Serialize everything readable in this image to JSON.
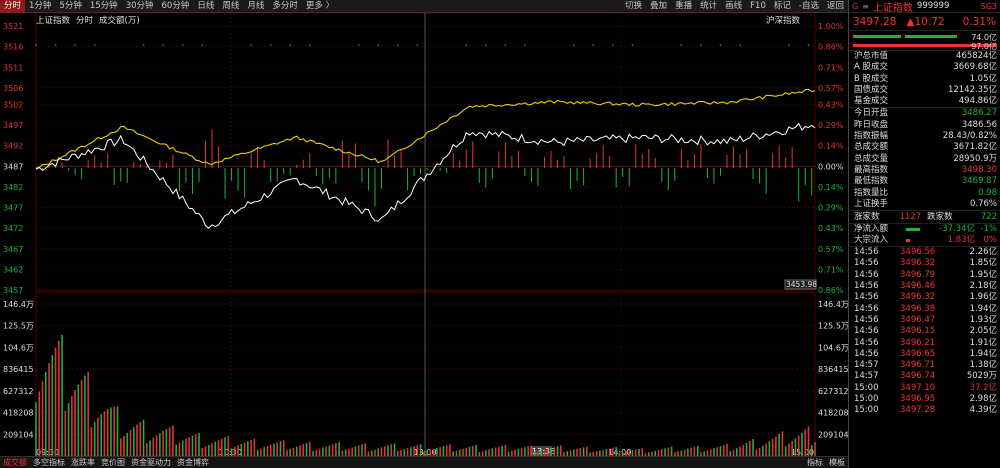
{
  "toolbar": {
    "left": [
      "分时",
      "1分钟",
      "5分钟",
      "15分钟",
      "30分钟",
      "60分钟",
      "日线",
      "周线",
      "月线",
      "多分时",
      "更多 〉"
    ],
    "right": [
      "切换",
      "叠加",
      "重播",
      "统计",
      "画线",
      "F10",
      "标记",
      "-自选",
      "返回"
    ]
  },
  "chart_head": {
    "index": "上证指数",
    "label": "分时",
    "vol_label": "成交额(万)",
    "right": "沪深指数"
  },
  "axes": {
    "price_left": [
      "3521",
      "3516",
      "3511",
      "3506",
      "3502",
      "3497",
      "3492",
      "3487",
      "3482",
      "3477",
      "3472",
      "3467",
      "3462",
      "3457"
    ],
    "pct_right": [
      "1.00%",
      "0.86%",
      "0.71%",
      "0.57%",
      "0.43%",
      "0.29%",
      "0.14%",
      "0.00%",
      "0.14%",
      "0.29%",
      "0.43%",
      "0.57%",
      "0.71%",
      "0.86%"
    ],
    "low_marker": "3453.98",
    "vol_left": [
      "146.4万",
      "125.5万",
      "104.6万",
      "836415",
      "627312",
      "418208",
      "209104"
    ],
    "vol_right": [
      "146.4万",
      "125.5万",
      "104.6万",
      "836415",
      "627312",
      "418208",
      "209104"
    ],
    "time": [
      "09:30",
      "10:30",
      "13:00",
      "14:00",
      "15:00"
    ],
    "cursor_time": "13:38"
  },
  "bottom_tabs": {
    "left": [
      "成交额",
      "多空指标",
      "涨跌率",
      "竞价图",
      "资金驱动力",
      "资金博弈"
    ],
    "right": [
      "指标",
      "模板"
    ]
  },
  "panel": {
    "g": "G",
    "eq": "≡",
    "name": "上证指数",
    "code": "999999",
    "sg": "SG3",
    "price": "3497.28",
    "change": "▲10.72",
    "pct": "0.31%",
    "ratio_top": "74.0亿",
    "ratio_bottom": "97.0亿",
    "stats": [
      {
        "label": "沪总市值",
        "value": "465824亿",
        "color": "white"
      },
      {
        "label": "A 股成交",
        "value": "3669.68亿",
        "color": "white"
      },
      {
        "label": "B 股成交",
        "value": "1.05亿",
        "color": "white"
      },
      {
        "label": "国债成交",
        "value": "12142.35亿",
        "color": "white"
      },
      {
        "label": "基金成交",
        "value": "494.86亿",
        "color": "white"
      }
    ],
    "quotes": [
      {
        "label": "今日开盘",
        "value": "3486.27",
        "color": "green"
      },
      {
        "label": "昨日收盘",
        "value": "3486.56",
        "color": "white"
      },
      {
        "label": "指数振幅",
        "value": "28.43/0.82%",
        "color": "white"
      },
      {
        "label": "总成交额",
        "value": "3671.82亿",
        "color": "white"
      },
      {
        "label": "总成交量",
        "value": "28950.9万",
        "color": "white"
      },
      {
        "label": "最高指数",
        "value": "3498.30",
        "color": "red"
      },
      {
        "label": "最低指数",
        "value": "3469.87",
        "color": "green"
      },
      {
        "label": "指数量比",
        "value": "0.98",
        "color": "green"
      },
      {
        "label": "上证换手",
        "value": "0.76%",
        "color": "white"
      }
    ],
    "updown": {
      "up_label": "涨家数",
      "up": "1127",
      "down_label": "跌家数",
      "down": "722"
    },
    "flows": [
      {
        "label": "净流入额",
        "value": "-37.34亿",
        "pct": "-1%",
        "color": "green"
      },
      {
        "label": "大宗流入",
        "value": "1.83亿",
        "pct": "0%",
        "color": "red"
      }
    ],
    "ticks": [
      {
        "time": "14:56",
        "price": "3496.56",
        "vol": "2.26亿",
        "vc": "white"
      },
      {
        "time": "14:56",
        "price": "3496.32",
        "vol": "1.85亿",
        "vc": "white"
      },
      {
        "time": "14:56",
        "price": "3496.79",
        "vol": "1.95亿",
        "vc": "white"
      },
      {
        "time": "14:56",
        "price": "3496.46",
        "vol": "2.18亿",
        "vc": "white"
      },
      {
        "time": "14:56",
        "price": "3496.32",
        "vol": "1.96亿",
        "vc": "white"
      },
      {
        "time": "14:56",
        "price": "3496.38",
        "vol": "1.94亿",
        "vc": "white"
      },
      {
        "time": "14:56",
        "price": "3496.47",
        "vol": "1.93亿",
        "vc": "white"
      },
      {
        "time": "14:56",
        "price": "3496.15",
        "vol": "2.05亿",
        "vc": "white"
      },
      {
        "time": "14:56",
        "price": "3496.21",
        "vol": "1.91亿",
        "vc": "white"
      },
      {
        "time": "14:56",
        "price": "3496.65",
        "vol": "1.94亿",
        "vc": "white"
      },
      {
        "time": "14:57",
        "price": "3496.71",
        "vol": "1.38亿",
        "vc": "white"
      },
      {
        "time": "14:57",
        "price": "3496.74",
        "vol": "5029万",
        "vc": "white"
      },
      {
        "time": "15:00",
        "price": "3497.10",
        "vol": "37.2亿",
        "vc": "red"
      },
      {
        "time": "15:00",
        "price": "3496.95",
        "vol": "2.98亿",
        "vc": "white"
      },
      {
        "time": "15:00",
        "price": "3497.28",
        "vol": "4.39亿",
        "vc": "white"
      }
    ]
  },
  "colors": {
    "up": "#e33333",
    "down": "#1fb23a",
    "price_line": "#ffffff",
    "avg_line": "#e6d200",
    "bg": "#000000"
  },
  "chart_data": {
    "type": "line",
    "prev_close": 3486.56,
    "ylim": [
      3457,
      3521
    ],
    "vol_ylim": [
      0,
      1464000
    ],
    "x": [
      "09:30",
      "10:00",
      "10:30",
      "11:00",
      "11:30",
      "13:00",
      "13:30",
      "14:00",
      "14:30",
      "15:00"
    ],
    "series": [
      {
        "values": [
          3486.3,
          3493.5,
          3472.5,
          3484.0,
          3474.0,
          3495.5,
          3492.8,
          3493.9,
          3493.0,
          3497.3
        ]
      },
      {
        "values": [
          3486.3,
          3496.5,
          3487.5,
          3494.0,
          3488.0,
          3501.5,
          3502.6,
          3501.9,
          3502.5,
          3505.5
        ]
      }
    ],
    "volume_trend": [
      1150000,
      320000,
      160000,
      110000,
      95000,
      85000,
      80000,
      60000,
      90000,
      240000
    ]
  }
}
